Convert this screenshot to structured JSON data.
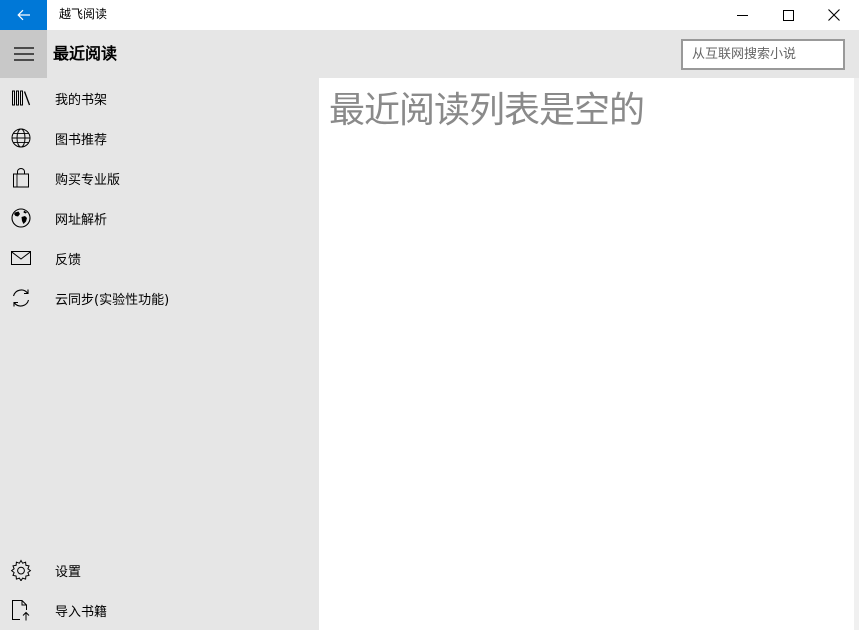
{
  "app": {
    "title": "越飞阅读"
  },
  "header": {
    "title": "最近阅读",
    "search_placeholder": "从互联网搜索小说"
  },
  "sidebar": {
    "items": [
      {
        "label": "我的书架",
        "icon": "bookshelf-icon"
      },
      {
        "label": "图书推荐",
        "icon": "globe-icon"
      },
      {
        "label": "购买专业版",
        "icon": "shopping-bag-icon"
      },
      {
        "label": "网址解析",
        "icon": "world-icon"
      },
      {
        "label": "反馈",
        "icon": "mail-icon"
      },
      {
        "label": "云同步(实验性功能)",
        "icon": "sync-icon"
      }
    ],
    "bottom_items": [
      {
        "label": "设置",
        "icon": "gear-icon"
      },
      {
        "label": "导入书籍",
        "icon": "import-file-icon"
      }
    ]
  },
  "main": {
    "empty_message": "最近阅读列表是空的"
  },
  "colors": {
    "accent": "#0078d7",
    "sidebar_bg": "#e6e6e6",
    "hamburger_bg": "#c8c8c8"
  }
}
